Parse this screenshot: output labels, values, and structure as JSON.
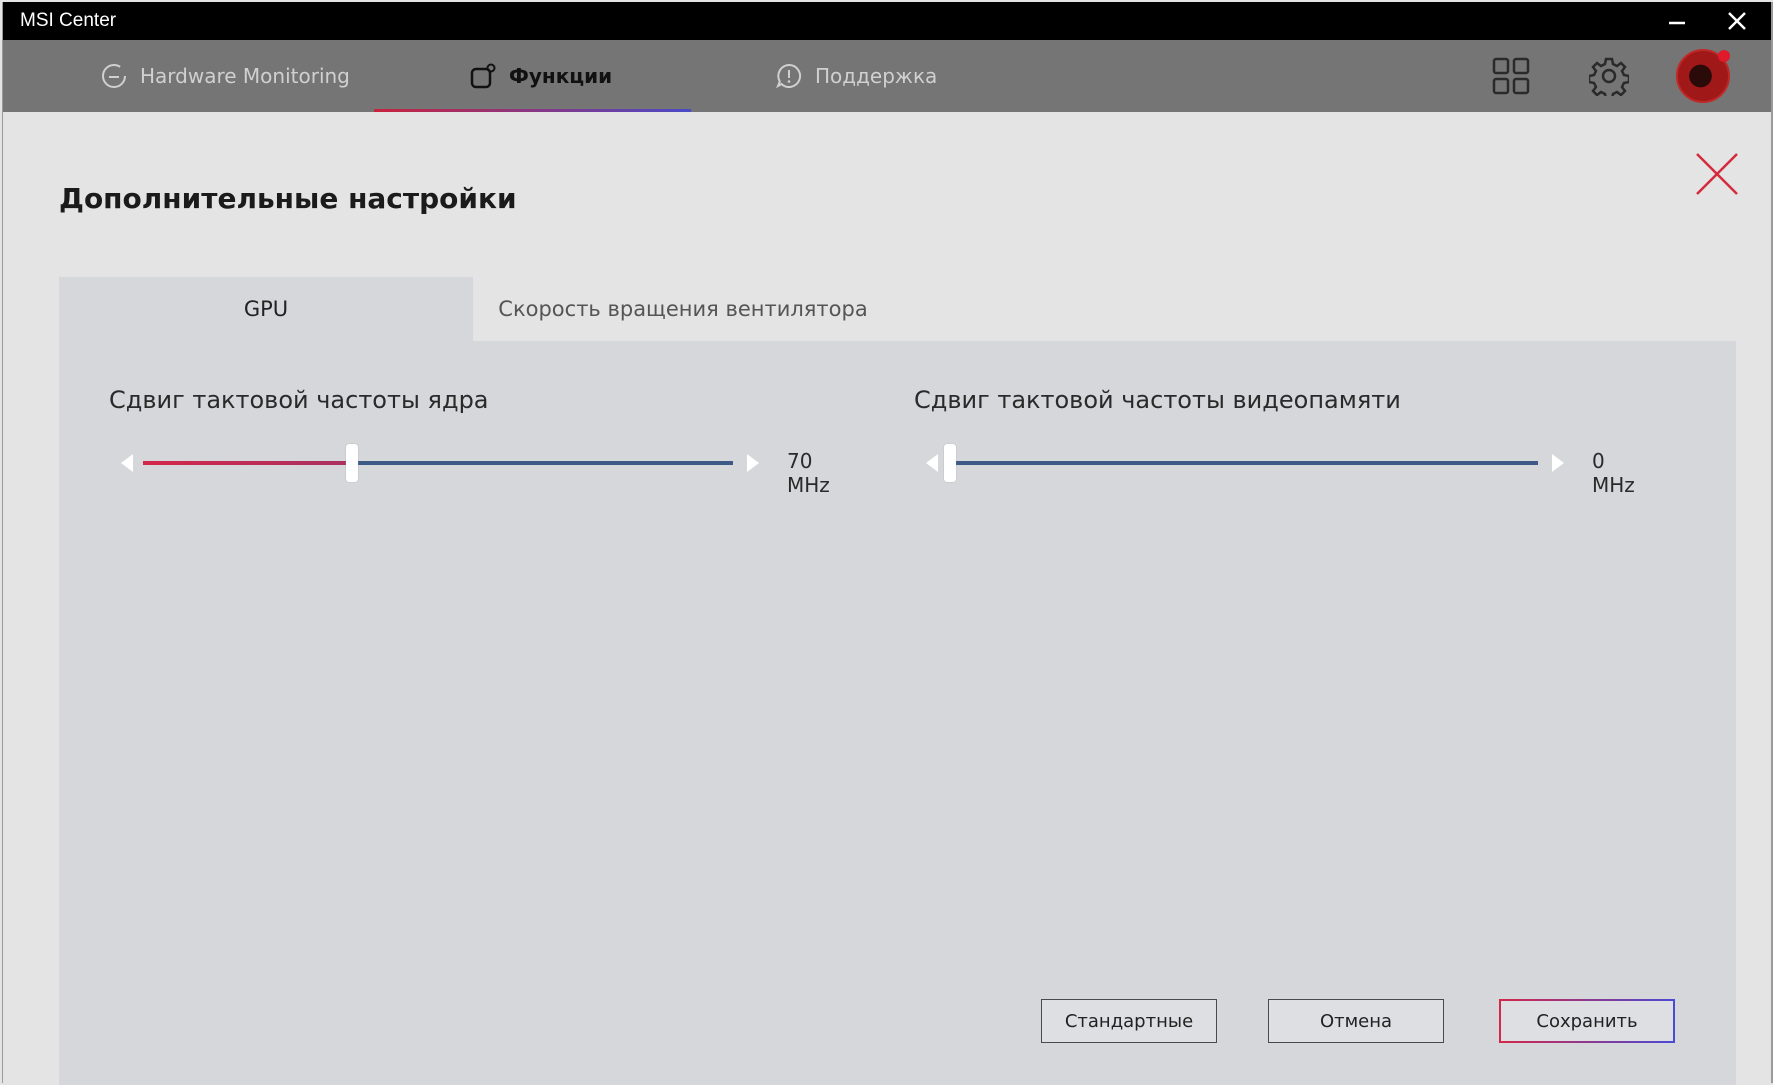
{
  "window": {
    "title": "MSI Center"
  },
  "nav": {
    "tabs": [
      {
        "label": "Hardware Monitoring",
        "icon": "gauge-icon",
        "active": false
      },
      {
        "label": "Функции",
        "icon": "features-icon",
        "active": true
      },
      {
        "label": "Поддержка",
        "icon": "support-chat-icon",
        "active": false
      }
    ],
    "right_icons": [
      "grid-apps-icon",
      "gear-icon",
      "avatar"
    ]
  },
  "dialog": {
    "title": "Дополнительные настройки",
    "tabs": [
      {
        "label": "GPU",
        "active": true
      },
      {
        "label": "Скорость вращения вентилятора",
        "active": false
      }
    ],
    "sliders": [
      {
        "label": "Сдвиг тактовой частоты ядра",
        "value_text": "70 MHz",
        "position_fraction": 0.35
      },
      {
        "label": "Сдвиг тактовой частоты видеопамяти",
        "value_text": "0 MHz",
        "position_fraction": 0.0
      }
    ],
    "buttons": {
      "defaults": "Стандартные",
      "cancel": "Отмена",
      "save": "Сохранить"
    }
  },
  "colors": {
    "accent_red": "#d4274a",
    "accent_blue": "#3d5a86",
    "nav_bg": "#757575",
    "panel_bg": "#d6d7da"
  }
}
